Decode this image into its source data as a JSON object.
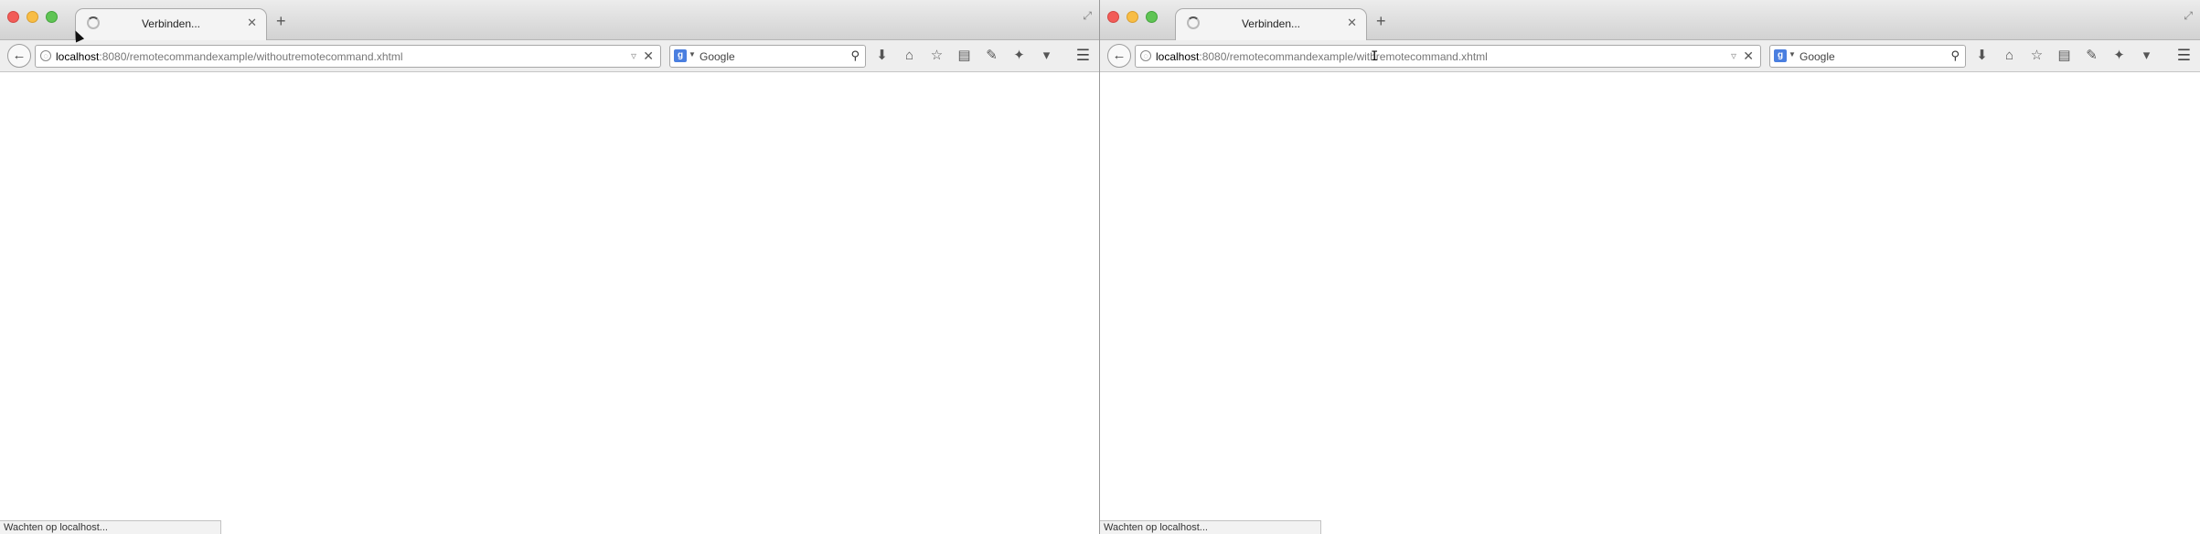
{
  "windows": [
    {
      "tab": {
        "title": "Verbinden..."
      },
      "url": {
        "host": "localhost",
        "rest": ":8080/remotecommandexample/withoutremotecommand.xhtml"
      },
      "search": {
        "placeholder": "Google",
        "engine_letter": "g"
      },
      "status": "Wachten op localhost..."
    },
    {
      "tab": {
        "title": "Verbinden..."
      },
      "url": {
        "host": "localhost",
        "rest": ":8080/remotecommandexample/withremotecommand.xhtml"
      },
      "search": {
        "placeholder": "Google",
        "engine_letter": "g"
      },
      "status": "Wachten op localhost..."
    }
  ],
  "icons": {
    "close-icon": "✕",
    "new-tab-icon": "+",
    "back-arrow-icon": "←",
    "stop-icon": "✕",
    "search-icon": "⚲",
    "download-icon": "⬇",
    "home-icon": "⌂",
    "bookmark-star-icon": "☆",
    "bookmarks-menu-icon": "▤",
    "pocket-icon": "✎",
    "extensions-icon": "✦",
    "menu-icon": "☰"
  }
}
